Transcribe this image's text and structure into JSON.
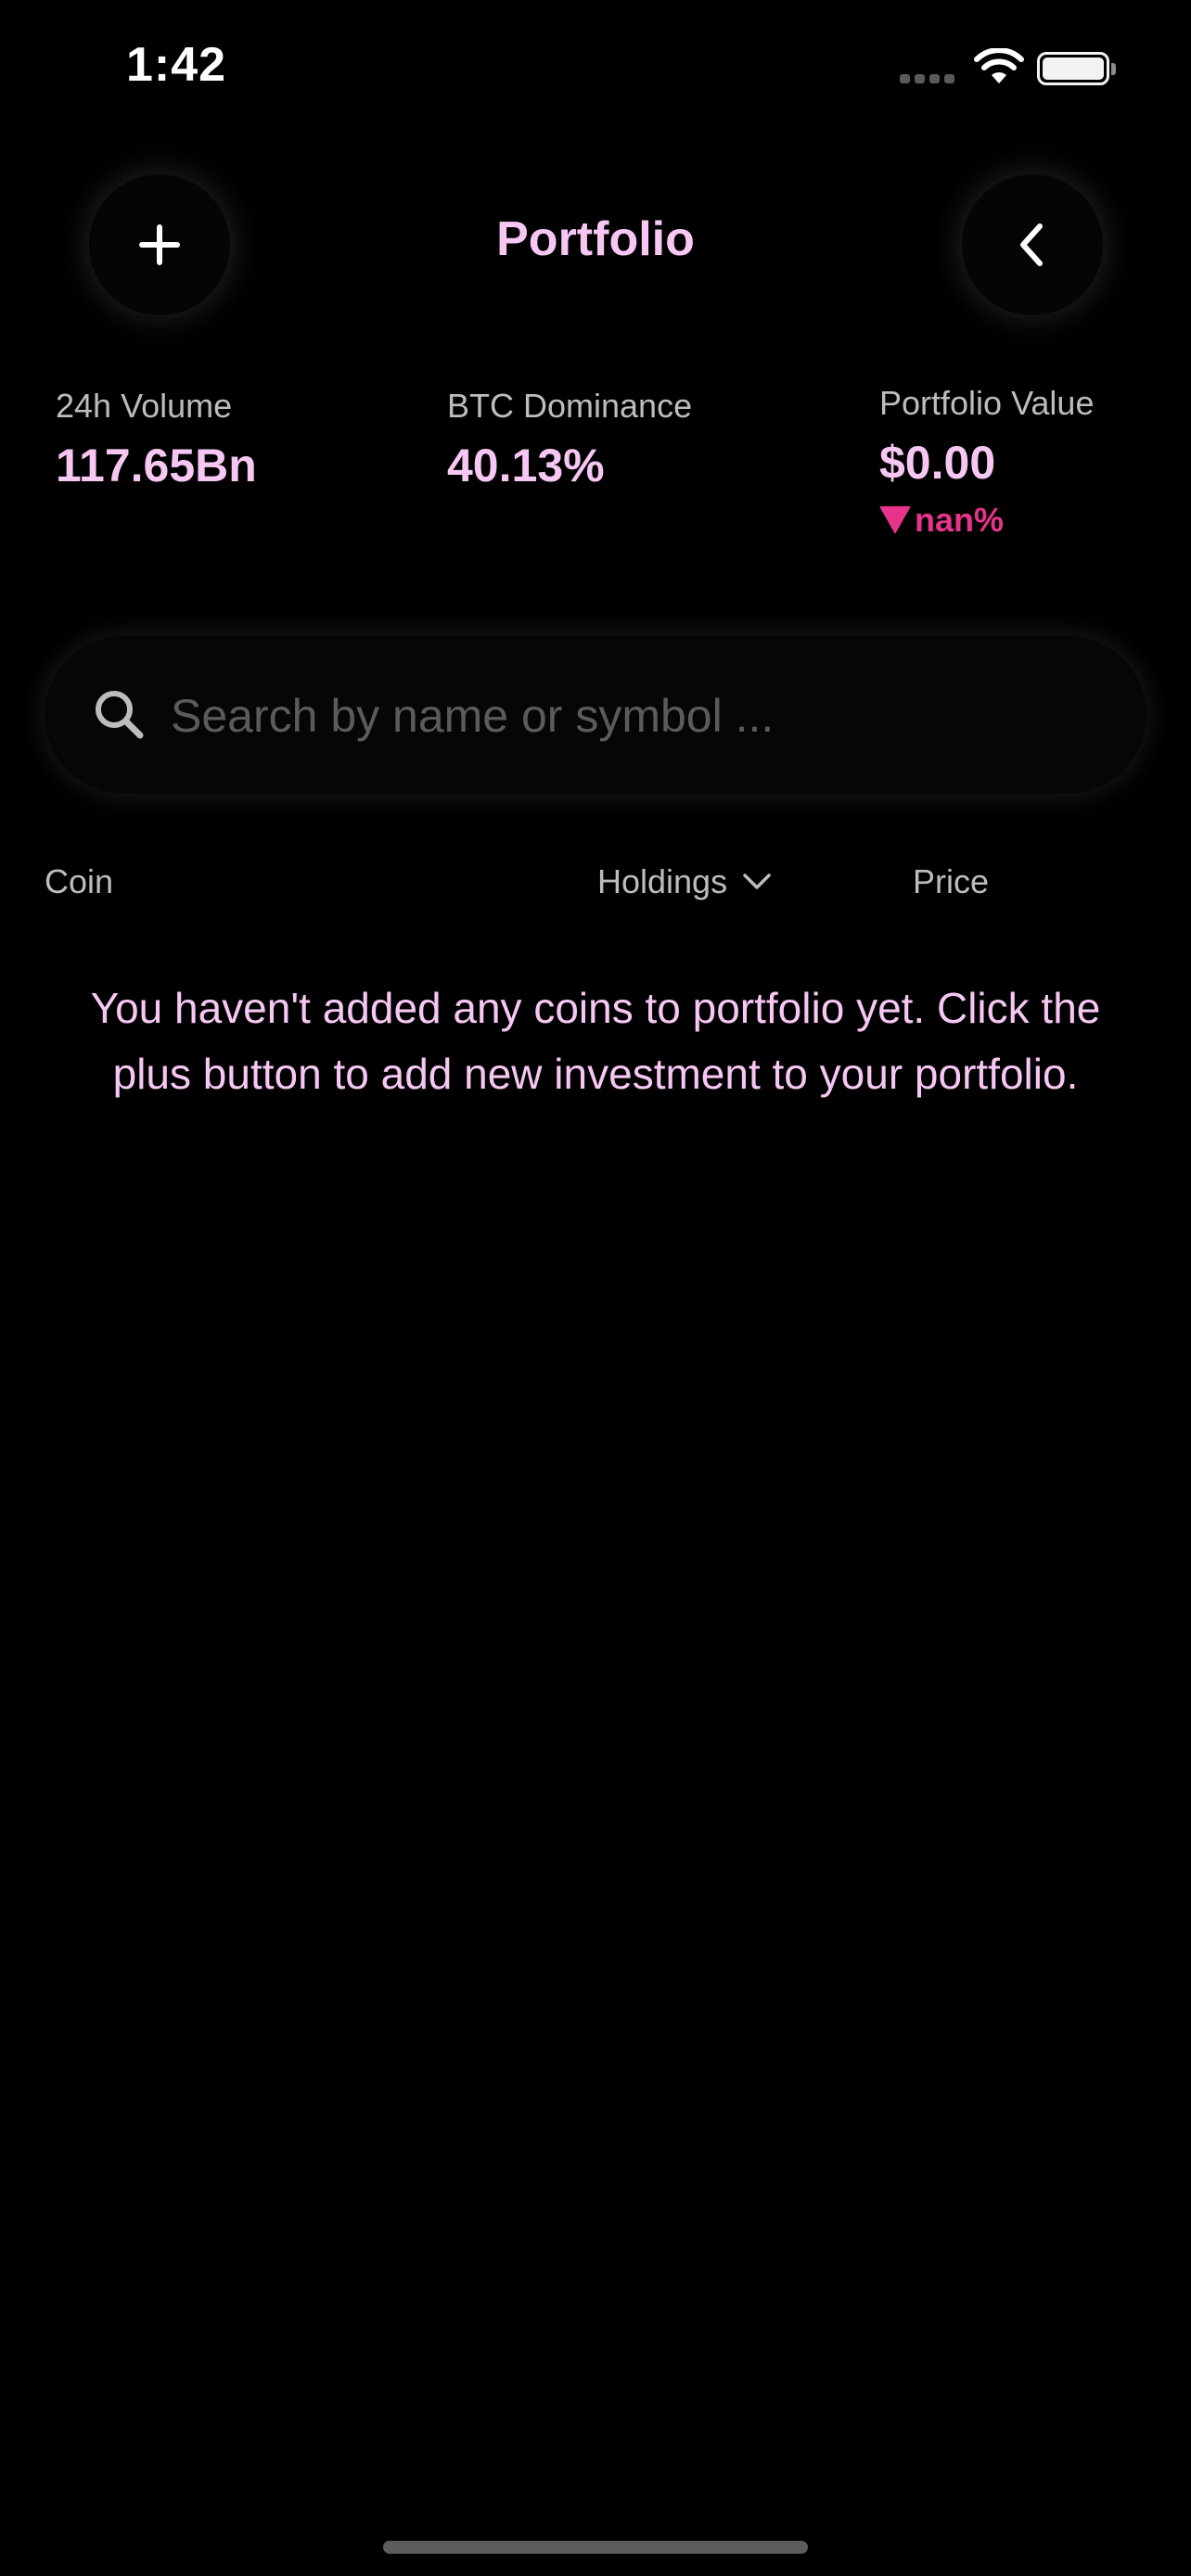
{
  "status_bar": {
    "time": "1:42",
    "icons": [
      "cellular-signal-icon",
      "wifi-icon",
      "battery-icon"
    ]
  },
  "header": {
    "title": "Portfolio",
    "left_button_icon": "plus-icon",
    "right_button_icon": "chevron-left-icon"
  },
  "stats": [
    {
      "label": "24h Volume",
      "value": "117.65Bn"
    },
    {
      "label": "BTC Dominance",
      "value": "40.13%"
    },
    {
      "label": "Portfolio Value",
      "value": "$0.00",
      "change": "nan%",
      "change_direction": "down"
    }
  ],
  "search": {
    "placeholder": "Search by name or symbol ...",
    "value": "",
    "icon": "search-icon"
  },
  "columns": {
    "coin": "Coin",
    "holdings": "Holdings",
    "price": "Price"
  },
  "empty_message": "You haven't added any coins to portfolio yet. Click the plus button to add new investment to your portfolio.",
  "colors": {
    "accent_pink": "#f7c7f4",
    "negative": "#e8338d",
    "background": "#000000",
    "secondary_text": "#bdbdbd"
  }
}
